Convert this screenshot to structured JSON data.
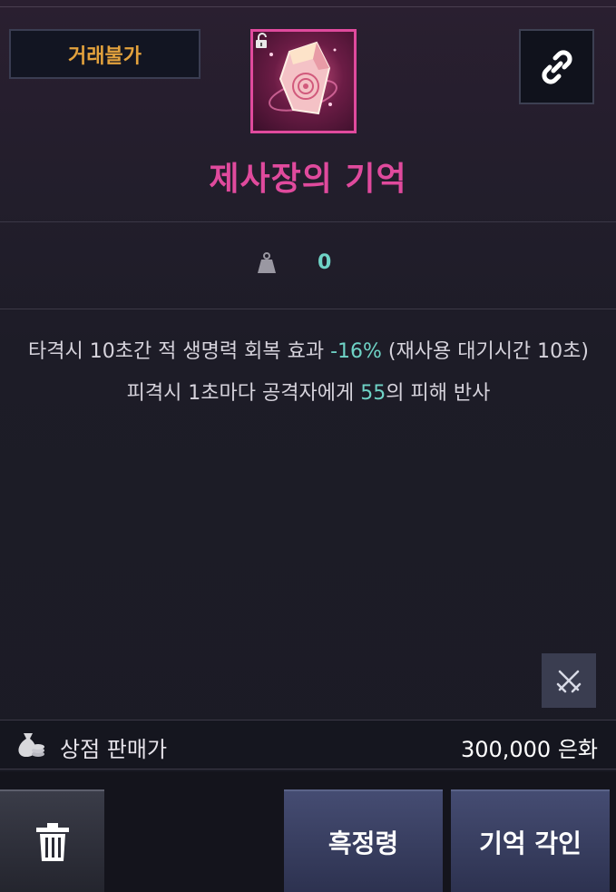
{
  "header": {
    "trade_badge": "거래불가",
    "item_name": "제사장의 기억",
    "link_icon": "link-icon",
    "item_icon": "crystal-item-icon",
    "lock_icon": "unlocked-padlock-icon"
  },
  "weight": {
    "icon": "weight-icon",
    "value": "0"
  },
  "effects": {
    "line1_pre": "타격시 10초간 적 생명력 회복 효과 ",
    "line1_num": "-16%",
    "line1_post": " (재사용 대기시간 10초)",
    "line2_pre": "피격시 1초마다 공격자에게 ",
    "line2_num": "55",
    "line2_post": "의 피해 반사"
  },
  "actions": {
    "crossed_swords_icon": "crossed-swords-icon",
    "delete_icon": "trash-icon",
    "black_spirit_label": "흑정령",
    "engrave_label": "기억 각인"
  },
  "price": {
    "icon": "money-bag-icon",
    "label": "상점 판매가",
    "value": "300,000 은화"
  },
  "colors": {
    "item_name": "#e04a9d",
    "trade_badge": "#e3a23d",
    "highlight_number": "#6fd3c6"
  }
}
